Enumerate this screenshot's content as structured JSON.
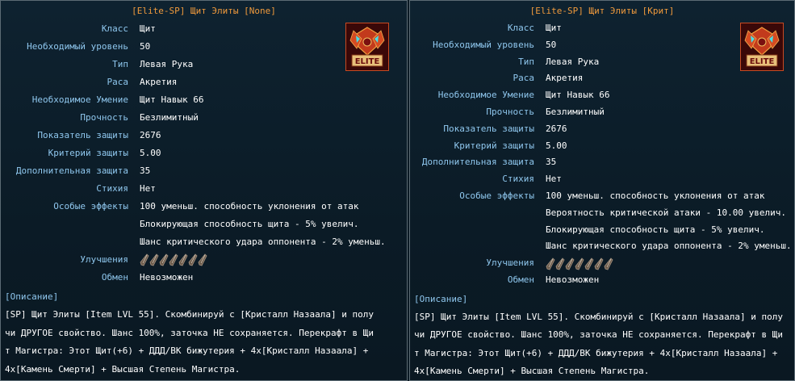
{
  "tooltips": [
    {
      "title": "[Elite-SP] Щит Элиты [None]",
      "stats": [
        {
          "label": "Класс",
          "value": "Щит"
        },
        {
          "label": "Необходимый уровень",
          "value": "50"
        },
        {
          "label": "Тип",
          "value": "Левая Рука"
        },
        {
          "label": "Раса",
          "value": "Акретия"
        },
        {
          "label": "Необходимое Умение",
          "value": "Щит Навык 66"
        },
        {
          "label": "Прочность",
          "value": "Безлимитный"
        },
        {
          "label": "Показатель защиты",
          "value": "2676"
        },
        {
          "label": "Критерий защиты",
          "value": "5.00"
        },
        {
          "label": "Дополнительная защита",
          "value": "35"
        },
        {
          "label": "Стихия",
          "value": "Нет"
        }
      ],
      "effects_label": "Особые эффекты",
      "effects": [
        "100 уменьш. способность уклонения от атак",
        "Блокирующая способность щита - 5% увелич.",
        "Шанс критического удара оппонента - 2% уменьш."
      ],
      "upgrades_label": "Улучшения",
      "upgrade_slots": 7,
      "trade_label": "Обмен",
      "trade_value": "Невозможен",
      "desc_header": "[Описание]",
      "desc_lines": [
        "[SP] Щит Элиты [Item LVL 55]. Скомбинируй с [Кристалл Назаала] и полу",
        "чи ДРУГОЕ свойство. Шанс 100%, заточка НЕ сохраняется. Перекрафт в Щи",
        "т Магистра: Этот Щит(+6) + ДДД/ВК бижутерия + 4x[Кристалл Назаала] +",
        "4x[Камень Смерти] + Высшая Степень Магистра."
      ],
      "icon_text": "ELITE"
    },
    {
      "title": "[Elite-SP] Щит Элиты [Крит]",
      "stats": [
        {
          "label": "Класс",
          "value": "Щит"
        },
        {
          "label": "Необходимый уровень",
          "value": "50"
        },
        {
          "label": "Тип",
          "value": "Левая Рука"
        },
        {
          "label": "Раса",
          "value": "Акретия"
        },
        {
          "label": "Необходимое Умение",
          "value": "Щит Навык 66"
        },
        {
          "label": "Прочность",
          "value": "Безлимитный"
        },
        {
          "label": "Показатель защиты",
          "value": "2676"
        },
        {
          "label": "Критерий защиты",
          "value": "5.00"
        },
        {
          "label": "Дополнительная защита",
          "value": "35"
        },
        {
          "label": "Стихия",
          "value": "Нет"
        }
      ],
      "effects_label": "Особые эффекты",
      "effects": [
        "100 уменьш. способность уклонения от атак",
        "Вероятность критической атаки - 10.00 увелич.",
        "Блокирующая способность щита - 5% увелич.",
        "Шанс критического удара оппонента - 2% уменьш."
      ],
      "upgrades_label": "Улучшения",
      "upgrade_slots": 7,
      "trade_label": "Обмен",
      "trade_value": "Невозможен",
      "desc_header": "[Описание]",
      "desc_lines": [
        "[SP] Щит Элиты [Item LVL 55]. Скомбинируй с [Кристалл Назаала] и полу",
        "чи ДРУГОЕ свойство. Шанс 100%, заточка НЕ сохраняется. Перекрафт в Щи",
        "т Магистра: Этот Щит(+6) + ДДД/ВК бижутерия + 4x[Кристалл Назаала] +",
        "4x[Камень Смерти] + Высшая Степень Магистра."
      ],
      "icon_text": "ELITE"
    }
  ],
  "colors": {
    "title": "#f09a3c",
    "label": "#8fc7ee",
    "value": "#ffffff",
    "background": "#0b1a24",
    "border": "#5c6b74"
  },
  "icons": {
    "item": "elite-shield-icon",
    "upgrade_slot": "empty-upgrade-slot-icon"
  }
}
